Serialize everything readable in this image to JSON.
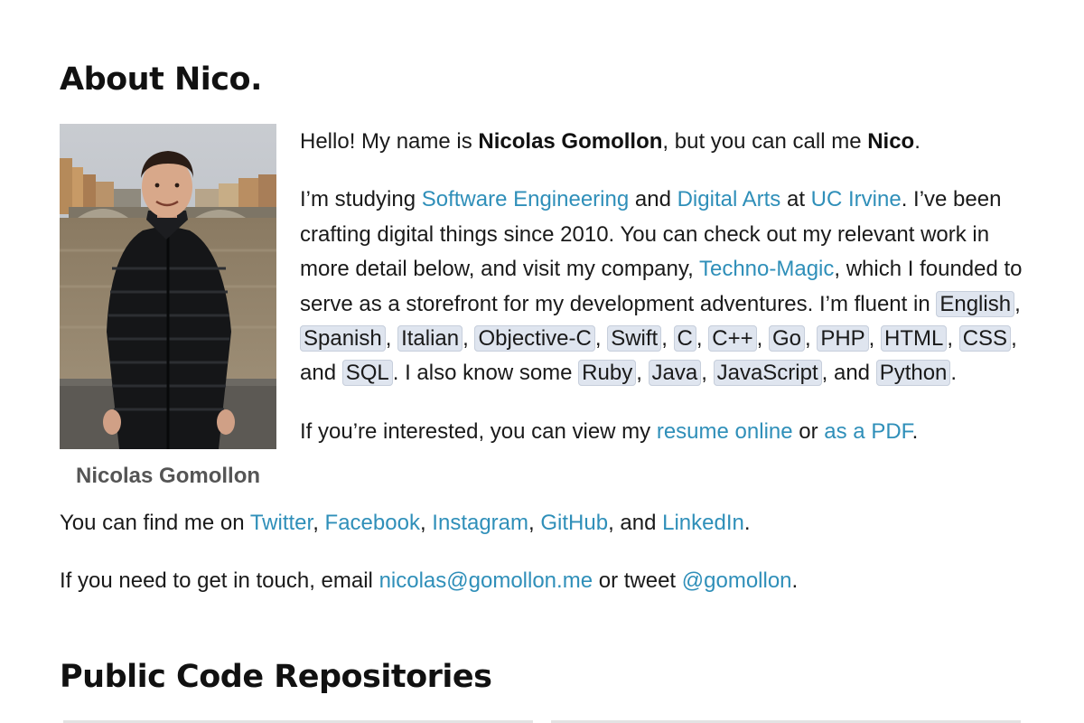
{
  "about": {
    "heading": "About Nico.",
    "caption": "Nicolas Gomollon",
    "intro": {
      "t1": "Hello! My name is ",
      "full_name": "Nicolas Gomollon",
      "t2": ", but you can call me ",
      "short_name": "Nico",
      "t3": "."
    },
    "study": {
      "t1": "I’m studying ",
      "link1": "Software Engineering",
      "t2": " and ",
      "link2": "Digital Arts",
      "t3": " at ",
      "link3": "UC Irvine",
      "t4": ". I’ve been crafting digital things since 2010. You can check out my relevant work in more detail below, and visit my company, ",
      "link4": "Techno-Magic",
      "t5": ", which I founded to serve as a storefront for my development adventures. I’m fluent in ",
      "fluent": [
        "English",
        "Spanish",
        "Italian",
        "Objective-C",
        "Swift",
        "C",
        "C++",
        "Go",
        "PHP",
        "HTML",
        "CSS",
        "SQL"
      ],
      "t6": ". I also know some ",
      "know": [
        "Ruby",
        "Java",
        "JavaScript",
        "Python"
      ],
      "t7": "."
    },
    "resume": {
      "t1": "If you’re interested, you can view my ",
      "link1": "resume online",
      "t2": " or ",
      "link2": "as a PDF",
      "t3": "."
    },
    "find": {
      "t1": "You can find me on ",
      "links": [
        "Twitter",
        "Facebook",
        "Instagram",
        "GitHub",
        "LinkedIn"
      ],
      "t_and": ", and ",
      "t_end": "."
    },
    "touch": {
      "t1": "If you need to get in touch, email ",
      "email": "nicolas@gomollon.me",
      "t2": " or tweet ",
      "handle": "@gomollon",
      "t3": "."
    }
  },
  "repos": {
    "heading": "Public Code Repositories"
  },
  "colors": {
    "link": "#2f8fb9",
    "code_bg": "#dfe5ef",
    "caption": "#555555"
  }
}
